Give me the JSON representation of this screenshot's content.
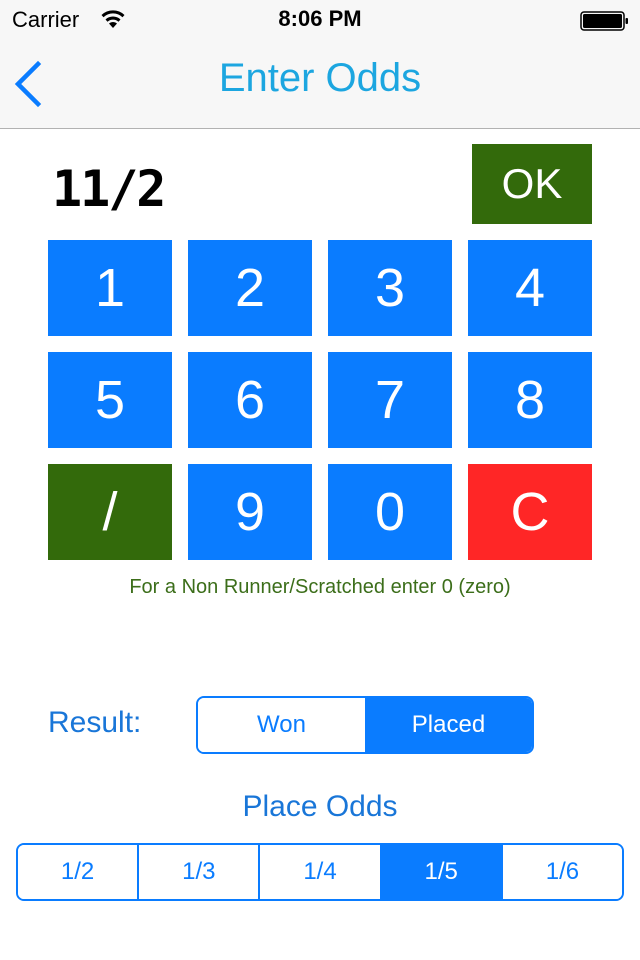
{
  "status_bar": {
    "carrier": "Carrier",
    "time": "8:06 PM",
    "wifi_icon": "wifi-icon",
    "battery_icon": "battery-full-icon"
  },
  "nav": {
    "title": "Enter Odds",
    "back_icon": "chevron-left-icon"
  },
  "odds_display": "11/2",
  "ok_label": "OK",
  "keypad": {
    "keys": [
      {
        "label": "1",
        "color": "#0a7cff"
      },
      {
        "label": "2",
        "color": "#0a7cff"
      },
      {
        "label": "3",
        "color": "#0a7cff"
      },
      {
        "label": "4",
        "color": "#0a7cff"
      },
      {
        "label": "5",
        "color": "#0a7cff"
      },
      {
        "label": "6",
        "color": "#0a7cff"
      },
      {
        "label": "7",
        "color": "#0a7cff"
      },
      {
        "label": "8",
        "color": "#0a7cff"
      },
      {
        "label": "/",
        "color": "#336a0b"
      },
      {
        "label": "9",
        "color": "#0a7cff"
      },
      {
        "label": "0",
        "color": "#0a7cff"
      },
      {
        "label": "C",
        "color": "#ff2626"
      }
    ]
  },
  "hint": "For a Non Runner/Scratched enter 0 (zero)",
  "result": {
    "label": "Result:",
    "options": [
      "Won",
      "Placed"
    ],
    "selected": "Placed"
  },
  "place_odds": {
    "title": "Place Odds",
    "options": [
      "1/2",
      "1/3",
      "1/4",
      "1/5",
      "1/6"
    ],
    "selected": "1/5"
  },
  "colors": {
    "accent": "#0a7cff",
    "title": "#1ca6e0",
    "ok_green": "#336a0b",
    "clear_red": "#ff2626",
    "hint_green": "#3c6e1a"
  }
}
